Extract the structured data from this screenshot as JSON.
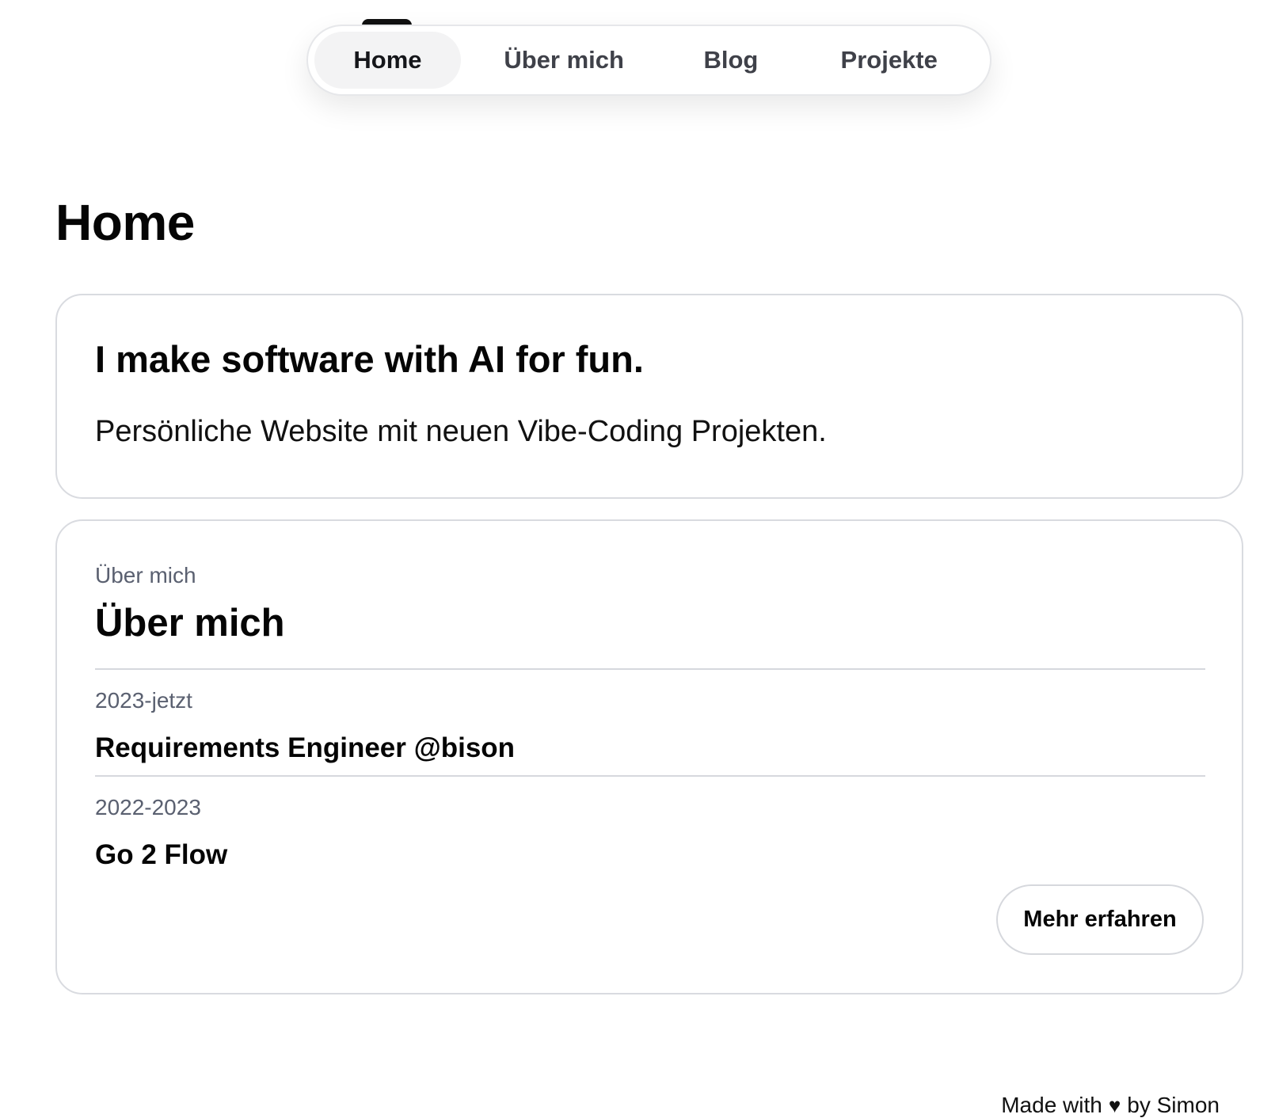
{
  "nav": {
    "items": [
      {
        "label": "Home",
        "active": true
      },
      {
        "label": "Über mich",
        "active": false
      },
      {
        "label": "Blog",
        "active": false
      },
      {
        "label": "Projekte",
        "active": false
      }
    ]
  },
  "page": {
    "title": "Home"
  },
  "hero": {
    "heading": "I make software with AI for fun.",
    "text": "Persönliche Website mit neuen Vibe-Coding Projekten."
  },
  "about": {
    "eyebrow": "Über mich",
    "title": "Über mich",
    "jobs": [
      {
        "period": "2023-jetzt",
        "title": "Requirements Engineer @bison"
      },
      {
        "period": "2022-2023",
        "title": "Go 2 Flow"
      }
    ],
    "button_label": "Mehr erfahren"
  },
  "footer": {
    "prefix": "Made with",
    "heart_icon": "heart-icon",
    "suffix": "by Simon"
  }
}
